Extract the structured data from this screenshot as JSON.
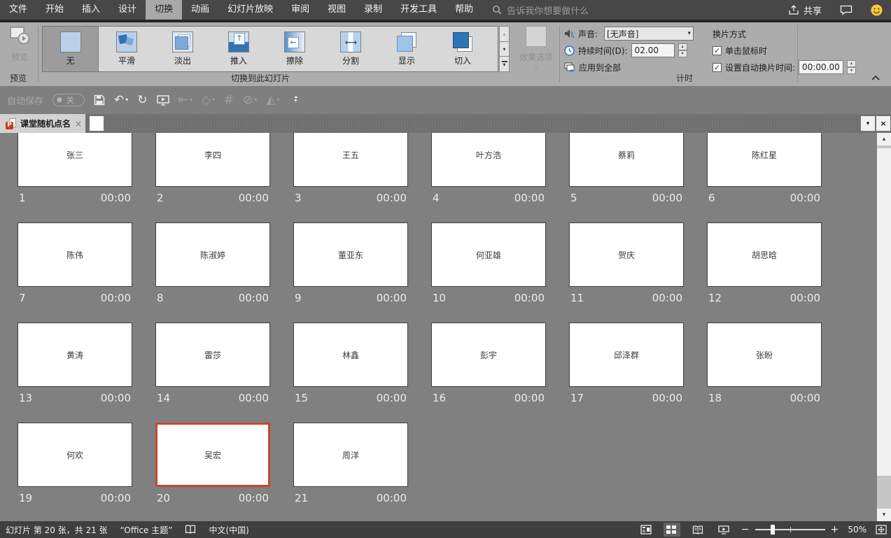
{
  "menu": {
    "tabs": [
      "文件",
      "开始",
      "插入",
      "设计",
      "切换",
      "动画",
      "幻灯片放映",
      "审阅",
      "视图",
      "录制",
      "开发工具",
      "帮助"
    ],
    "active_tab": "切换",
    "search_placeholder": "告诉我你想要做什么",
    "share_label": "共享"
  },
  "ribbon": {
    "preview": {
      "label": "预览",
      "group_label": "预览"
    },
    "gallery": {
      "items": [
        {
          "label": "无",
          "icon": "none"
        },
        {
          "label": "平滑",
          "icon": "morph"
        },
        {
          "label": "淡出",
          "icon": "fade"
        },
        {
          "label": "推入",
          "icon": "push"
        },
        {
          "label": "擦除",
          "icon": "wipe"
        },
        {
          "label": "分割",
          "icon": "split"
        },
        {
          "label": "显示",
          "icon": "reveal"
        },
        {
          "label": "切入",
          "icon": "cut"
        }
      ],
      "selected": "无",
      "group_label": "切换到此幻灯片"
    },
    "effect_options_label": "效果选项",
    "timing": {
      "sound_label": "声音:",
      "sound_value": "[无声音]",
      "duration_label": "持续时间(D):",
      "duration_value": "02.00",
      "apply_all_label": "应用到全部",
      "advance_label": "换片方式",
      "on_click_label": "单击鼠标时",
      "auto_advance_label": "设置自动换片时间:",
      "auto_advance_value": "00:00.00",
      "group_label": "计时"
    }
  },
  "qat": {
    "autosave_label": "自动保存",
    "autosave_state": "关"
  },
  "tabbar": {
    "document_tab": "课堂随机点名"
  },
  "slides": [
    {
      "n": 1,
      "name": "张三",
      "time": "00:00"
    },
    {
      "n": 2,
      "name": "李四",
      "time": "00:00"
    },
    {
      "n": 3,
      "name": "王五",
      "time": "00:00"
    },
    {
      "n": 4,
      "name": "叶方浩",
      "time": "00:00"
    },
    {
      "n": 5,
      "name": "蔡莉",
      "time": "00:00"
    },
    {
      "n": 6,
      "name": "陈红星",
      "time": "00:00"
    },
    {
      "n": 7,
      "name": "陈伟",
      "time": "00:00"
    },
    {
      "n": 8,
      "name": "陈淑婷",
      "time": "00:00"
    },
    {
      "n": 9,
      "name": "董亚东",
      "time": "00:00"
    },
    {
      "n": 10,
      "name": "何亚雄",
      "time": "00:00"
    },
    {
      "n": 11,
      "name": "贺庆",
      "time": "00:00"
    },
    {
      "n": 12,
      "name": "胡思晗",
      "time": "00:00"
    },
    {
      "n": 13,
      "name": "黄涛",
      "time": "00:00"
    },
    {
      "n": 14,
      "name": "雷莎",
      "time": "00:00"
    },
    {
      "n": 15,
      "name": "林鑫",
      "time": "00:00"
    },
    {
      "n": 16,
      "name": "彭宇",
      "time": "00:00"
    },
    {
      "n": 17,
      "name": "邱泽群",
      "time": "00:00"
    },
    {
      "n": 18,
      "name": "张盼",
      "time": "00:00"
    },
    {
      "n": 19,
      "name": "何欢",
      "time": "00:00"
    },
    {
      "n": 20,
      "name": "吴宏",
      "time": "00:00"
    },
    {
      "n": 21,
      "name": "周洋",
      "time": "00:00"
    }
  ],
  "selected_slide": 20,
  "statusbar": {
    "slide_info": "幻灯片 第 20 张，共 21 张",
    "theme": "“Office 主题”",
    "language": "中文(中国)",
    "zoom": "50%"
  },
  "icons": {
    "caret_up": "▴",
    "caret_down": "▾",
    "undo": "↶",
    "redo": "↻",
    "close_x": "×",
    "check": "✓",
    "toggle_dot": "●",
    "hash": "#",
    "slashed_circle": "⊘",
    "flip_triangles": "◭",
    "diamond": "◇",
    "indent_arrow": "⇤",
    "minus": "−",
    "plus": "+"
  },
  "colors": {
    "selection": "#C8472B",
    "ppt_icon": "#C43E1C",
    "smiley": "#FFC83D",
    "icon_blue": "#2E75B6"
  }
}
